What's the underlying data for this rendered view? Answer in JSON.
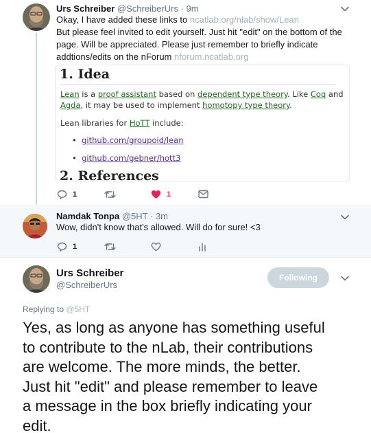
{
  "tweet1": {
    "name": "Urs Schreiber",
    "handle": "@SchreiberUrs",
    "time": "· 9m",
    "text_l1": "Okay, I have added these links to ",
    "link1": "ncatlab.org/nlab/show/Lean",
    "text_l2": "But please feel invited to edit yourself. Just hit \"edit\" on the bottom of the",
    "text_l3": "page. Will be appreciated. Please just remember to briefly indicate",
    "text_l4": "addtions/edits on the nForum ",
    "link2": "nforum.ncatlab.org",
    "card": {
      "heading": "1. Idea",
      "p1_lean": "Lean",
      "p1_a": " is a ",
      "p1_pa": "proof assistant",
      "p1_b": " based on ",
      "p1_dtt": "dependent type theory",
      "p1_c": ". Like ",
      "p1_coq": "Coq",
      "p1_d": " and",
      "p2_agda": "Agda",
      "p2_a": ", it may be used to implement ",
      "p2_hott": "homotopy type theory",
      "p2_b": ".",
      "p3_a": "Lean libraries for ",
      "p3_hott": "HoTT",
      "p3_b": " include:",
      "bullet1": "github.com/groupoid/lean",
      "bullet2": "github.com/gebner/hott3",
      "heading2": "2. References"
    },
    "actions": {
      "replies": "1",
      "retweets": "",
      "likes": "1"
    }
  },
  "tweet2": {
    "name": "Namdak Tonpa",
    "handle": "@5HT",
    "time": "· 3m",
    "text": "Wow, didn't know that's allowed. Will do for sure! <3",
    "actions": {
      "replies": "1",
      "retweets": "",
      "likes": ""
    }
  },
  "tweet3": {
    "name": "Urs Schreiber",
    "handle": "@SchreiberUrs",
    "follow_label": "Following",
    "replying_prefix": "Replying to ",
    "replying_to": "@5HT",
    "lines": [
      "Yes, as long as anyone has something useful",
      "to contribute to the nLab, their contributions",
      "are welcome. The more minds, the better.",
      "Just hit \"edit\" and please remember to leave",
      "a message in the box briefly indicating your",
      "edit."
    ]
  },
  "colors": {
    "like_red": "#e0245e",
    "link_gray": "#a6b3bd",
    "secondary_text": "#657786",
    "following_button": "#ccd6dd"
  }
}
